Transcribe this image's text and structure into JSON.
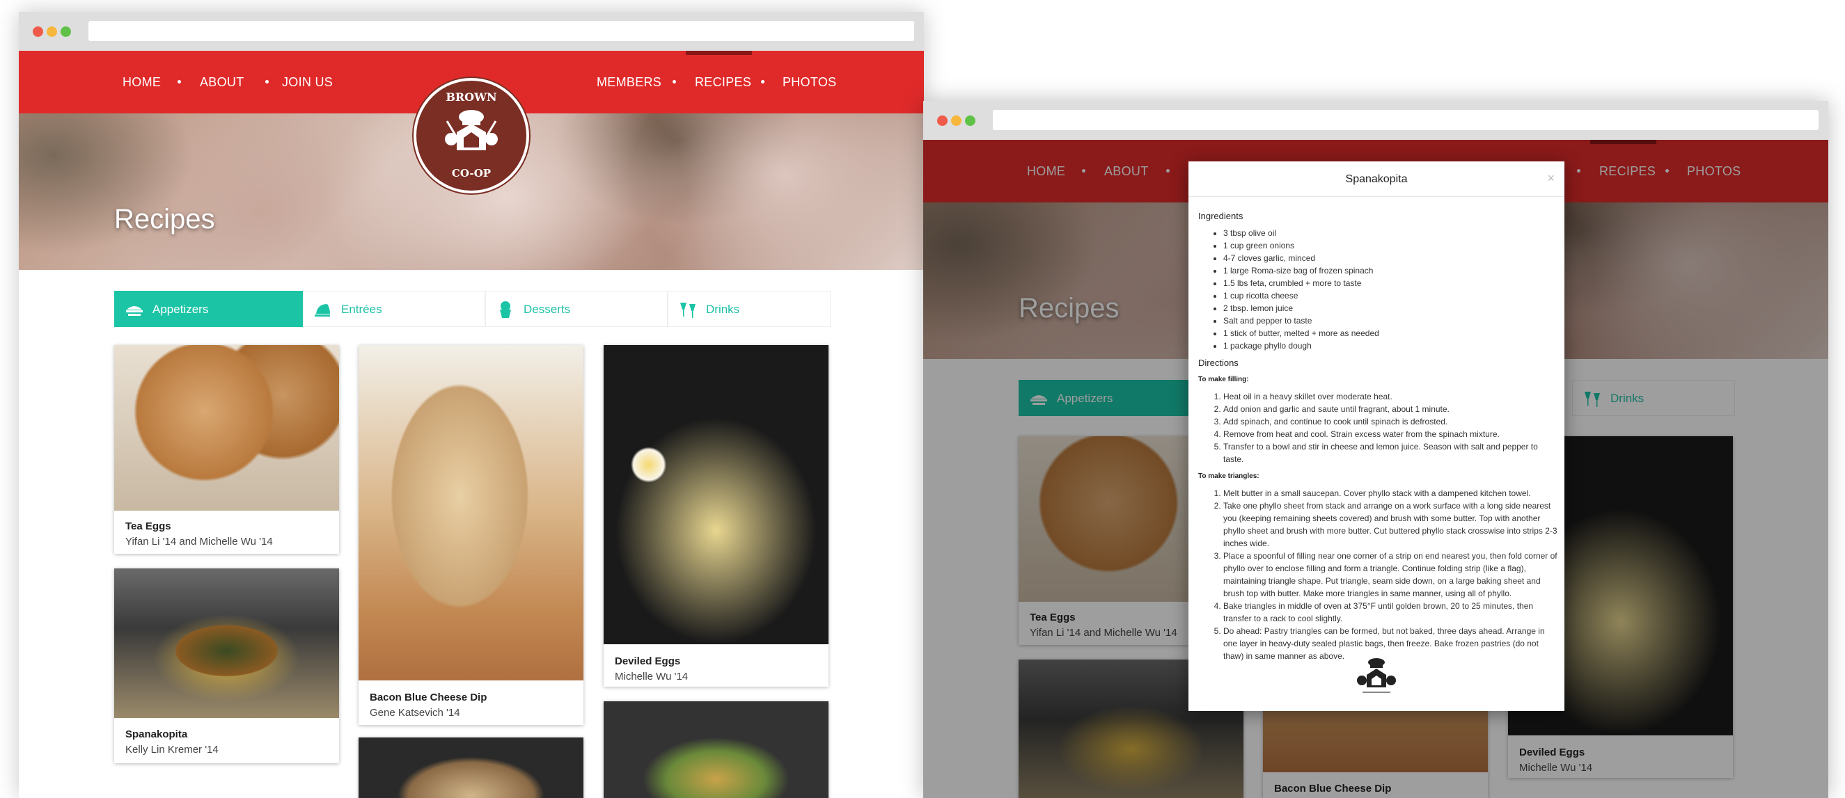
{
  "nav": {
    "left": [
      "HOME",
      "ABOUT",
      "JOIN US"
    ],
    "right": [
      "MEMBERS",
      "RECIPES",
      "PHOTOS"
    ]
  },
  "logo": {
    "top": "BROWN",
    "bottom": "CO-OP"
  },
  "hero": {
    "title": "Recipes"
  },
  "tabs": [
    {
      "label": "Appetizers",
      "icon": "plate-icon"
    },
    {
      "label": "Entrées",
      "icon": "cloche-icon"
    },
    {
      "label": "Desserts",
      "icon": "cupcake-icon"
    },
    {
      "label": "Drinks",
      "icon": "glasses-icon"
    }
  ],
  "cards": [
    {
      "title": "Tea Eggs",
      "by": "Yifan Li '14 and Michelle Wu '14"
    },
    {
      "title": "Spanakopita",
      "by": "Kelly Lin Kremer '14"
    },
    {
      "title": "Bacon Blue Cheese Dip",
      "by": "Gene Katsevich '14"
    },
    {
      "title": "Deviled Eggs",
      "by": "Michelle Wu '14"
    }
  ],
  "modal": {
    "title": "Spanakopita",
    "close": "×",
    "ingredients_heading": "Ingredients",
    "ingredients": [
      "3 tbsp olive oil",
      "1 cup green onions",
      "4-7 cloves garlic, minced",
      "1 large Roma-size bag of frozen spinach",
      "1.5 lbs feta, crumbled + more to taste",
      "1 cup ricotta cheese",
      "2 tbsp. lemon juice",
      "Salt and pepper to taste",
      "1 stick of butter, melted + more as needed",
      "1 package phyllo dough"
    ],
    "directions_heading": "Directions",
    "filling_heading": "To make filling:",
    "filling": [
      "Heat oil in a heavy skillet over moderate heat.",
      "Add onion and garlic and saute until fragrant, about 1 minute.",
      "Add spinach, and continue to cook until spinach is defrosted.",
      "Remove from heat and cool. Strain excess water from the spinach mixture.",
      "Transfer to a bowl and stir in cheese and lemon juice. Season with salt and pepper to taste."
    ],
    "triangles_heading": "To make triangles:",
    "triangles": [
      "Melt butter in a small saucepan. Cover phyllo stack with a dampened kitchen towel.",
      "Take one phyllo sheet from stack and arrange on a work surface with a long side nearest you (keeping remaining sheets covered) and brush with some butter. Top with another phyllo sheet and brush with more butter. Cut buttered phyllo stack crosswise into strips 2-3 inches wide.",
      "Place a spoonful of filling near one corner of a strip on end nearest you, then fold corner of phyllo over to enclose filling and form a triangle. Continue folding strip (like a flag), maintaining triangle shape. Put triangle, seam side down, on a large baking sheet and brush top with butter. Make more triangles in same manner, using all of phyllo.",
      "Bake triangles in middle of oven at 375°F until golden brown, 20 to 25 minutes, then transfer to a rack to cool slightly.",
      "Do ahead: Pastry triangles can be formed, but not baked, three days ahead. Arrange in one layer in heavy-duty sealed plastic bags, then freeze. Bake frozen pastries (do not thaw) in same manner as above."
    ]
  },
  "colors": {
    "red": "#e02a2a",
    "teal": "#1cc4a6",
    "brown": "#7a2e24"
  }
}
